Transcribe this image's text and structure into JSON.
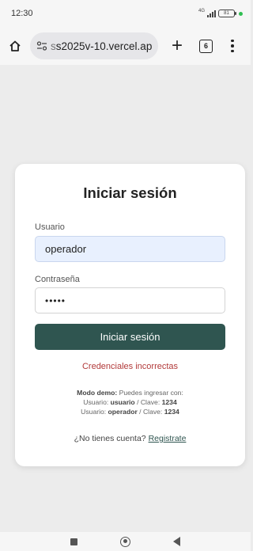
{
  "status_bar": {
    "time": "12:30",
    "network": "4G",
    "battery": "81"
  },
  "browser": {
    "url_dim": "s",
    "url_main": "s2025v-10.vercel.app",
    "tab_count": "6",
    "plus_label": "+"
  },
  "login": {
    "title": "Iniciar sesión",
    "username_label": "Usuario",
    "username_value": "operador",
    "password_label": "Contraseña",
    "password_value": "•••••",
    "submit_label": "Iniciar sesión",
    "error": "Credenciales incorrectas",
    "demo_prefix": "Modo demo:",
    "demo_intro": " Puedes ingresar con:",
    "demo_line1_a": "Usuario: ",
    "demo_line1_user": "usuario",
    "demo_line1_b": " / Clave: ",
    "demo_line1_pass": "1234",
    "demo_line2_a": "Usuario: ",
    "demo_line2_user": "operador",
    "demo_line2_b": " / Clave: ",
    "demo_line2_pass": "1234",
    "register_question": "¿No tienes cuenta? ",
    "register_link": "Registrate"
  },
  "colors": {
    "accent": "#2f5550",
    "error": "#b23a3a",
    "autofill": "#e8f0fe"
  }
}
